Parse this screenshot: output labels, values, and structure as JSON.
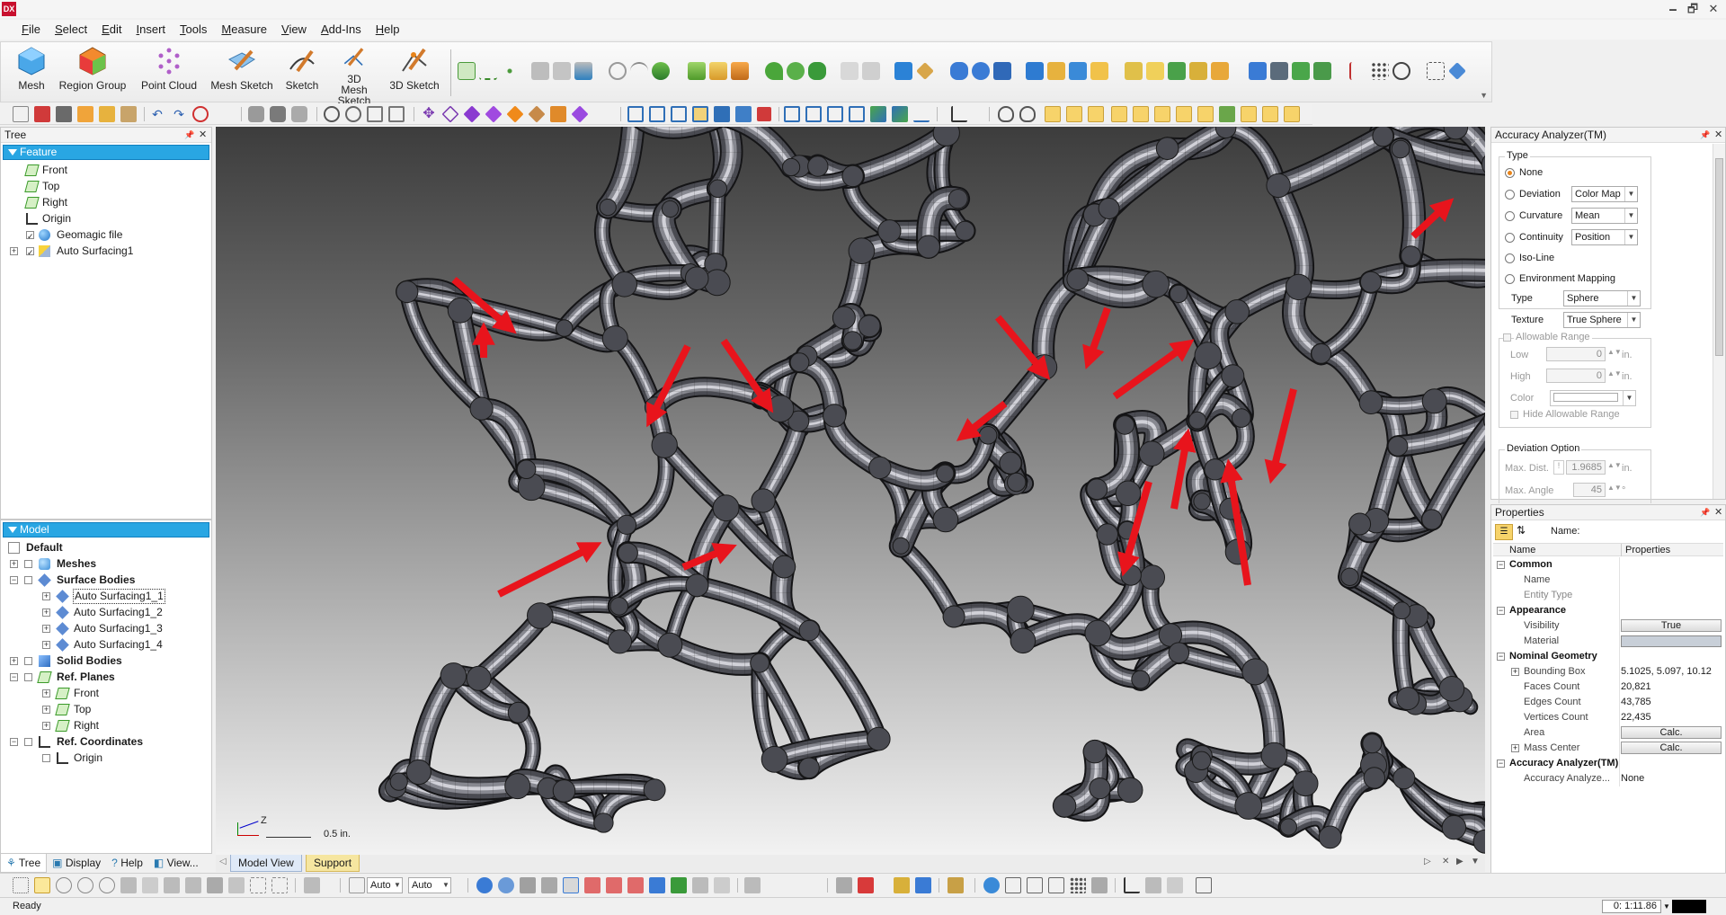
{
  "app": {
    "logo": "DX"
  },
  "window_controls": [
    "🗕",
    "🗗",
    "✕"
  ],
  "menu": [
    "File",
    "Select",
    "Edit",
    "Insert",
    "Tools",
    "Measure",
    "View",
    "Add-Ins",
    "Help"
  ],
  "ribbon": {
    "buttons": [
      {
        "label": "Mesh",
        "icon": "mesh-icon"
      },
      {
        "label": "Region Group",
        "icon": "region-group-icon"
      },
      {
        "label": "Point Cloud",
        "icon": "point-cloud-icon"
      },
      {
        "label": "Mesh Sketch",
        "icon": "mesh-sketch-icon"
      },
      {
        "label": "Sketch",
        "icon": "sketch-icon"
      },
      {
        "label": "3D Mesh Sketch",
        "icon": "3d-mesh-sketch-icon"
      },
      {
        "label": "3D Sketch",
        "icon": "3d-sketch-icon"
      }
    ]
  },
  "tree_panel": {
    "title": "Tree",
    "pin": "📌",
    "close": "✕",
    "feature_header": "Feature",
    "feature_items": [
      "Front",
      "Top",
      "Right",
      "Origin",
      "Geomagic file",
      "Auto Surfacing1"
    ],
    "model_header": "Model",
    "model_items": [
      "Default",
      "Meshes",
      "Surface Bodies",
      "Auto Surfacing1_1",
      "Auto Surfacing1_2",
      "Auto Surfacing1_3",
      "Auto Surfacing1_4",
      "Solid Bodies",
      "Ref. Planes",
      "Front",
      "Top",
      "Right",
      "Ref. Coordinates",
      "Origin"
    ],
    "tabs": [
      "Tree",
      "Display",
      "Help",
      "View..."
    ]
  },
  "viewport": {
    "scale_label": "0.5 in.",
    "axis_label": "Z",
    "colors": {
      "arrow": "#e8141c",
      "struts": "#4a4b52"
    }
  },
  "view_tabs": [
    "Model View",
    "Support"
  ],
  "accuracy_panel": {
    "title": "Accuracy Analyzer(TM)",
    "type_legend": "Type",
    "options": [
      "None",
      "Deviation",
      "Curvature",
      "Continuity",
      "Iso-Line",
      "Environment Mapping"
    ],
    "selected": "None",
    "deviation_combo": "Color Map",
    "curvature_combo": "Mean",
    "continuity_combo": "Position",
    "env_type_label": "Type",
    "env_type_value": "Sphere",
    "texture_label": "Texture",
    "texture_value": "True Sphere",
    "allowable_range_label": "Allowable Range",
    "low_label": "Low",
    "low_value": "0",
    "high_label": "High",
    "high_value": "0",
    "unit": "in.",
    "color_label": "Color",
    "hide_label": "Hide Allowable Range",
    "deviation_option_legend": "Deviation Option",
    "max_dist_label": "Max. Dist.",
    "max_dist_value": "1.9685",
    "max_angle_label": "Max. Angle",
    "max_angle_value": "45",
    "angle_unit": "°"
  },
  "properties_panel": {
    "title": "Properties",
    "name_label": "Name:",
    "col_name": "Name",
    "col_props": "Properties",
    "cat_common": "Common",
    "name_key": "Name",
    "entity_type_key": "Entity Type",
    "cat_appearance": "Appearance",
    "visibility_key": "Visibility",
    "visibility_value": "True",
    "material_key": "Material",
    "cat_nominal": "Nominal Geometry",
    "bbox_key": "Bounding Box",
    "bbox_value": "5.1025, 5.097, 10.12",
    "faces_key": "Faces Count",
    "faces_value": "20,821",
    "edges_key": "Edges Count",
    "edges_value": "43,785",
    "vertices_key": "Vertices Count",
    "vertices_value": "22,435",
    "area_key": "Area",
    "area_value": "Calc.",
    "mass_key": "Mass Center",
    "mass_value": "Calc.",
    "cat_accuracy": "Accuracy Analyzer(TM)",
    "acc_key": "Accuracy Analyze...",
    "acc_value": "None"
  },
  "bottom_toolbar": {
    "combo1": "Auto",
    "combo2": "Auto"
  },
  "status": {
    "text": "Ready",
    "time": "0: 1:11.86"
  }
}
